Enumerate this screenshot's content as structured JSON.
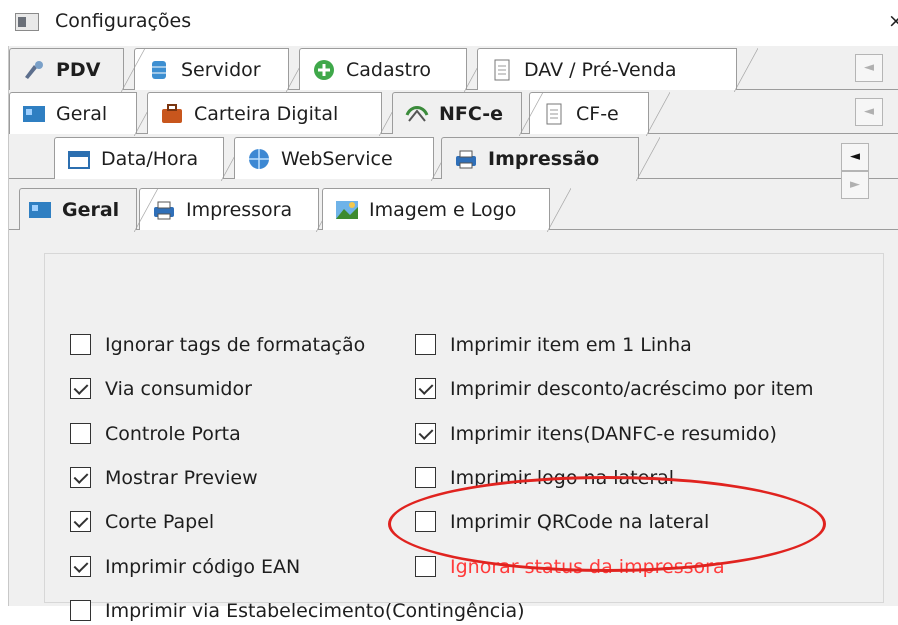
{
  "window": {
    "title": "Configurações",
    "close_glyph": "×"
  },
  "tabs_level1": [
    {
      "label": "PDV",
      "icon": "pdv-tools-icon",
      "active": true
    },
    {
      "label": "Servidor",
      "icon": "database-icon",
      "active": false
    },
    {
      "label": "Cadastro",
      "icon": "add-green-icon",
      "active": false
    },
    {
      "label": "DAV / Pré-Venda",
      "icon": "document-icon",
      "active": false
    }
  ],
  "tabs_level2": [
    {
      "label": "Geral",
      "icon": "geral-icon",
      "active": false
    },
    {
      "label": "Carteira Digital",
      "icon": "briefcase-icon",
      "active": false
    },
    {
      "label": "NFC-e",
      "icon": "nfce-icon",
      "active": true
    },
    {
      "label": "CF-e",
      "icon": "document-icon",
      "active": false
    }
  ],
  "tabs_level3": [
    {
      "label": "Data/Hora",
      "icon": "calendar-icon",
      "active": false
    },
    {
      "label": "WebService",
      "icon": "globe-icon",
      "active": false
    },
    {
      "label": "Impressão",
      "icon": "printer-icon",
      "active": true
    }
  ],
  "tabs_level4": [
    {
      "label": "Geral",
      "icon": "geral-icon",
      "active": true
    },
    {
      "label": "Impressora",
      "icon": "printer-icon",
      "active": false
    },
    {
      "label": "Imagem e Logo",
      "icon": "image-icon",
      "active": false
    }
  ],
  "scroll_glyphs": {
    "left": "◄",
    "right": "►"
  },
  "options_left": [
    {
      "label": "Ignorar tags de formatação",
      "checked": false
    },
    {
      "label": "Via consumidor",
      "checked": true
    },
    {
      "label": "Controle Porta",
      "checked": false
    },
    {
      "label": "Mostrar Preview",
      "checked": true
    },
    {
      "label": "Corte Papel",
      "checked": true
    },
    {
      "label": "Imprimir código EAN",
      "checked": true
    },
    {
      "label": "Imprimir via Estabelecimento(Contingência)",
      "checked": false
    }
  ],
  "options_right": [
    {
      "label": "Imprimir item em 1 Linha",
      "checked": false
    },
    {
      "label": "Imprimir desconto/acréscimo por item",
      "checked": true
    },
    {
      "label": "Imprimir itens(DANFC-e resumido)",
      "checked": true
    },
    {
      "label": "Imprimir logo na lateral",
      "checked": false
    },
    {
      "label": "Imprimir QRCode na lateral",
      "checked": false
    },
    {
      "label": "Ignorar status da impressora",
      "checked": false,
      "highlight": true
    }
  ],
  "colors": {
    "highlight_text": "#ff3b3b",
    "highlight_circle": "#e0231f"
  }
}
